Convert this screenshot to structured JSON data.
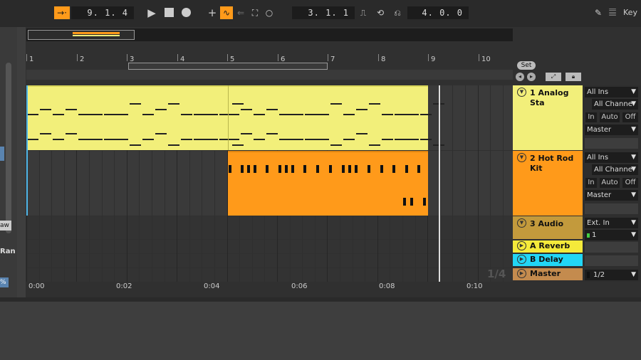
{
  "transport": {
    "arrangement_position": "9.  1.  4",
    "loop_start": "3.  1.  1",
    "loop_length": "4.  0.  0",
    "key_label": "Key"
  },
  "ruler": {
    "bars": [
      "1",
      "2",
      "3",
      "4",
      "5",
      "6",
      "7",
      "8",
      "9",
      "10"
    ],
    "times": [
      "0:00",
      "0:02",
      "0:04",
      "0:06",
      "0:08",
      "0:10"
    ],
    "set_label": "Set"
  },
  "tracks": [
    {
      "name": "1 Analog Sta",
      "color": "#f2ef7a",
      "input": "All Ins",
      "channel": "All Channe",
      "output": "Master"
    },
    {
      "name": "2 Hot Rod Kit",
      "color": "#ff9a1a",
      "input": "All Ins",
      "channel": "All Channe",
      "output": "Master"
    },
    {
      "name": "3 Audio",
      "color": "#c39a3c",
      "input": "Ext. In",
      "channel": "1"
    },
    {
      "name": "A Reverb",
      "color": "#f5ea3a"
    },
    {
      "name": "B Delay",
      "color": "#22d6f5"
    },
    {
      "name": "Master",
      "color": "#c48b4e",
      "output": "1/2"
    }
  ],
  "monitor": {
    "in": "In",
    "auto": "Auto",
    "off": "Off"
  },
  "left_panel": {
    "draw_label": "aw",
    "random_label": "Ran",
    "percent_label": "%"
  },
  "overview": {
    "zoom_label": "1/4"
  },
  "colors": {
    "accent": "#ff9a1a",
    "midi_clip": "#f2ef7a",
    "drum_clip": "#ff9a1a"
  }
}
